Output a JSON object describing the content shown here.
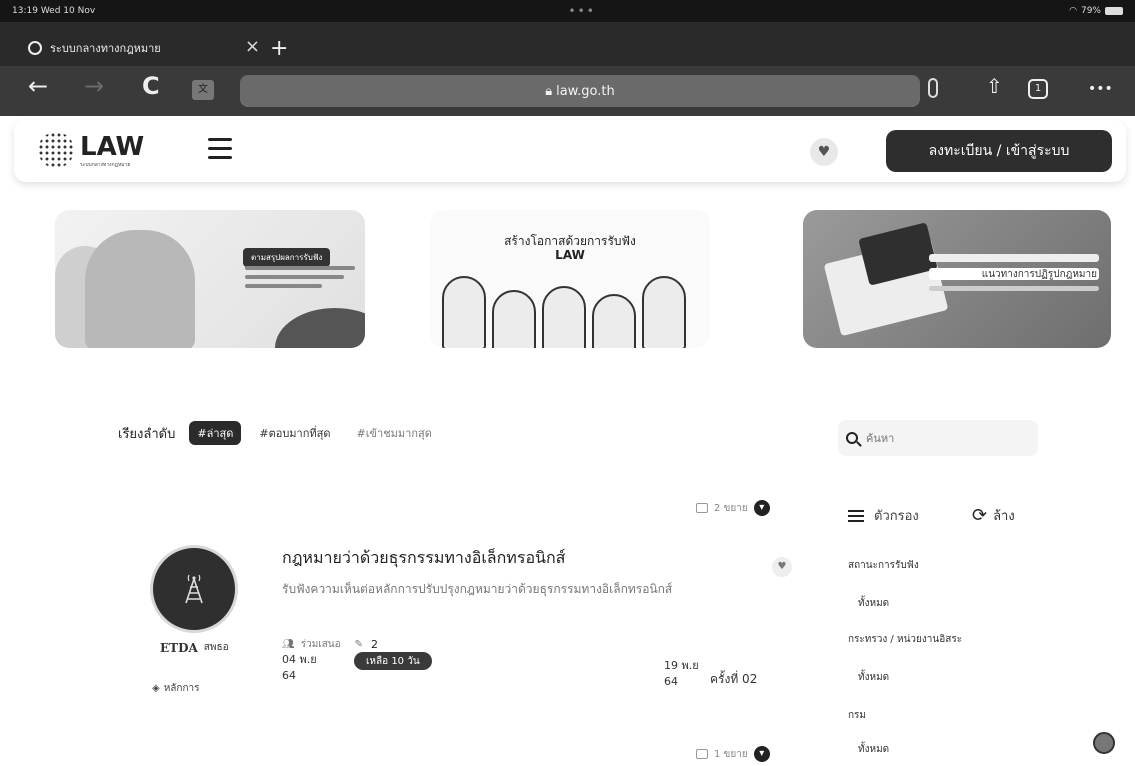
{
  "status_bar": {
    "time": "13:19",
    "date": "Wed 10 Nov",
    "more": "•••",
    "battery": "79%"
  },
  "browser": {
    "tab_title": "ระบบกลางทางกฎหมาย",
    "tab_close": "×",
    "new_tab": "+",
    "back": "←",
    "forward": "→",
    "reload": "C",
    "url": "law.go.th",
    "share": "⇧",
    "more": "•••"
  },
  "site": {
    "logo_text": "LAW",
    "logo_subtitle": "ระบบกลางทางกฎหมาย",
    "login_label": "ลงทะเบียน / เข้าสู่ระบบ"
  },
  "banners": [
    {
      "tag": "ตามสรุปผลการรับฟัง"
    },
    {
      "title": "สร้างโอกาสด้วยการรับฟัง",
      "logo": "LAW"
    },
    {
      "title": "แนวทางการปฏิรูปกฎหมาย"
    }
  ],
  "sort": {
    "label": "เรียงลำดับ",
    "options": [
      "#ล่าสุด",
      "#ตอบมากที่สุด",
      "#เข้าชมมากสุด"
    ],
    "active_index": 0
  },
  "search": {
    "placeholder": "ค้นหา"
  },
  "expand_rows": [
    "2 ขยาย",
    "1 ขยาย"
  ],
  "law_item": {
    "org_short": "ETDA",
    "org_name": "สพธอ",
    "category": "หลักการ",
    "title": "กฎหมายว่าด้วยธุรกรรมทางอิเล็กทรอนิกส์",
    "description": "รับฟังความเห็นต่อหลักการปรับปรุงกฎหมายว่าด้วยธุรกรรมทางอิเล็กทรอนิกส์",
    "proposal_label": "ร่วมเสนอ",
    "comment_count": "2",
    "start_date": "04 พ.ย",
    "start_year": "64",
    "remaining": "เหลือ 10 วัน",
    "remaining_fraction": 0.35,
    "end_date": "19 พ.ย",
    "end_year": "64",
    "round": "ครั้งที่ 02"
  },
  "filters": {
    "title": "ตัวกรอง",
    "reset": "ล้าง",
    "groups": [
      {
        "label": "สถานะการรับฟัง",
        "value": "ทั้งหมด"
      },
      {
        "label": "กระทรวง / หน่วยงานอิสระ",
        "value": "ทั้งหมด"
      },
      {
        "label": "กรม",
        "value": "ทั้งหมด"
      }
    ]
  }
}
